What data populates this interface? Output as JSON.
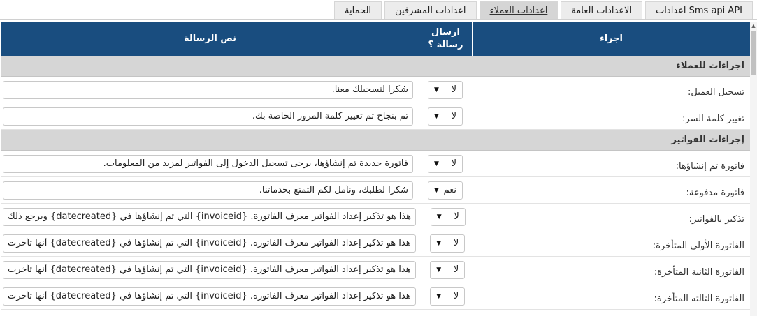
{
  "tabs": [
    {
      "label": "Sms api API اعدادات",
      "active": false
    },
    {
      "label": "الاعدادات العامة",
      "active": false
    },
    {
      "label": "اعدادات العملاء",
      "active": true
    },
    {
      "label": "اعدادات المشرفين",
      "active": false
    },
    {
      "label": "الحماية",
      "active": false
    }
  ],
  "header": {
    "action": "اجراء",
    "send": "ارسال رسالة ؟",
    "message": "نص الرسالة"
  },
  "sections": [
    {
      "title": "اجراءات للعملاء",
      "rows": [
        {
          "label": "تسجيل العميل:",
          "send": "لا",
          "message": "شكرا لتسجيلك معنا."
        },
        {
          "label": "تغيير كلمة السر:",
          "send": "لا",
          "message": "تم بنجاح تم تغيير كلمة المرور الخاصة بك."
        }
      ]
    },
    {
      "title": "إجراءات الفواتير",
      "rows": [
        {
          "label": "فاتورة تم إنشاؤها:",
          "send": "لا",
          "message": "فاتورة جديدة تم إنشاؤها، يرجى تسجيل الدخول إلى الفواتير لمزيد من المعلومات."
        },
        {
          "label": "فاتورة مدفوعة:",
          "send": "نعم",
          "message": "شكرا لطلبك، ونأمل لكم التمتع بخدماتنا."
        },
        {
          "label": "تذكير بالفواتير:",
          "send": "لا",
          "message": "هذا هو تذكير إعداد الفواتير معرف الفاتورة. {invoiceid} التي تم إنشاؤها في {datecreated} ويرجع ذلك"
        },
        {
          "label": "الفاتورة الأولى المتأخرة:",
          "send": "لا",
          "message": "هذا هو تذكير إعداد الفواتير معرف الفاتورة. {invoiceid} التي تم إنشاؤها في {datecreated} أنها تأخرت"
        },
        {
          "label": "الفاتورة الثانية المتأخرة:",
          "send": "لا",
          "message": "هذا هو تذكير إعداد الفواتير معرف الفاتورة. {invoiceid} التي تم إنشاؤها في {datecreated} أنها تأخرت"
        },
        {
          "label": "الفاتورة الثالثه المتأخرة:",
          "send": "لا",
          "message": "هذا هو تذكير إعداد الفواتير معرف الفاتورة. {invoiceid} التي تم إنشاؤها في {datecreated} أنها تأخرت"
        }
      ]
    }
  ],
  "colors": {
    "header_bg": "#194d7f",
    "section_bg": "#d6d6d6",
    "tab_active_bg": "#d5d5d5"
  },
  "icons": {
    "select_arrow": "caret-down-icon",
    "scroll_up": "scroll-up-arrow-icon"
  }
}
